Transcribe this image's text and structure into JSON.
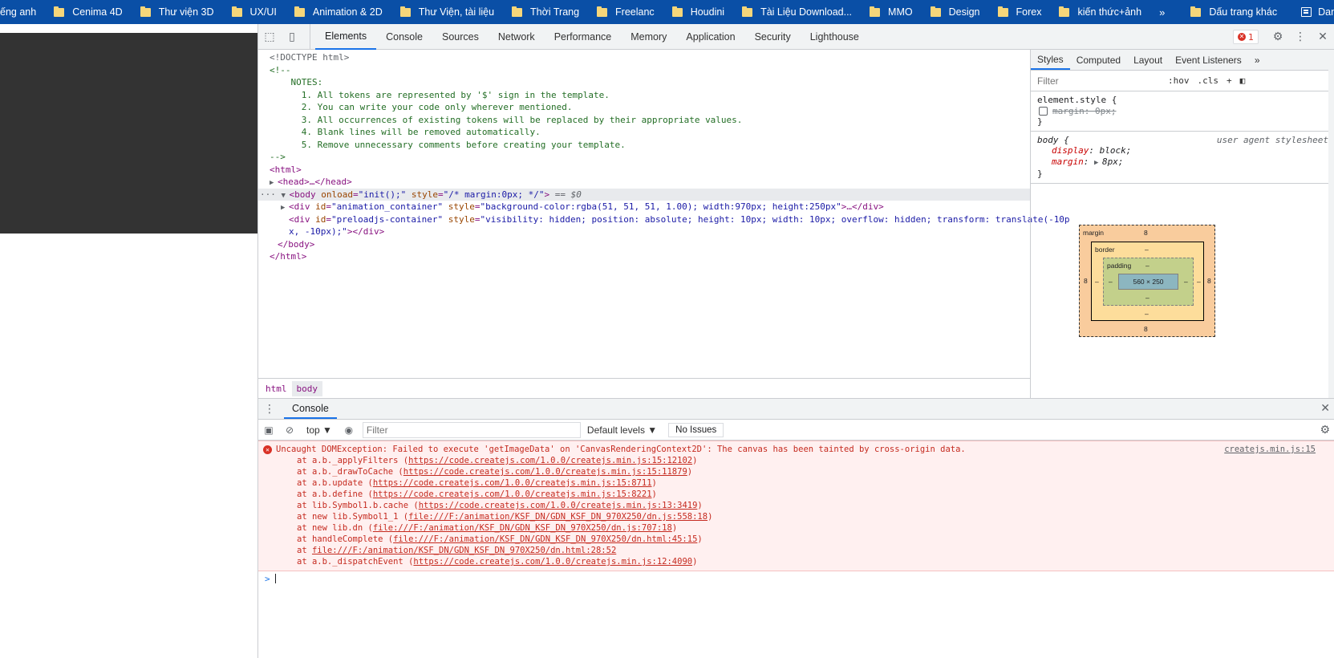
{
  "bookmarks": {
    "items": [
      {
        "label": "ếng anh",
        "has_folder": false
      },
      {
        "label": "Cenima 4D",
        "has_folder": true
      },
      {
        "label": "Thư viện 3D",
        "has_folder": true
      },
      {
        "label": "UX/UI",
        "has_folder": true
      },
      {
        "label": "Animation & 2D",
        "has_folder": true
      },
      {
        "label": "Thư Viện, tài liệu",
        "has_folder": true
      },
      {
        "label": "Thời Trang",
        "has_folder": true
      },
      {
        "label": "Freelanc",
        "has_folder": true
      },
      {
        "label": "Houdini",
        "has_folder": true
      },
      {
        "label": "Tài Liệu Download...",
        "has_folder": true
      },
      {
        "label": "MMO",
        "has_folder": true
      },
      {
        "label": "Design",
        "has_folder": true
      },
      {
        "label": "Forex",
        "has_folder": true
      },
      {
        "label": "kiến thức+ảnh",
        "has_folder": true
      }
    ],
    "overflow": "»",
    "other_bookmarks": "Dấu trang khác",
    "reading_list": "Danh sách đọc"
  },
  "devtools": {
    "tabs": [
      "Elements",
      "Console",
      "Sources",
      "Network",
      "Performance",
      "Memory",
      "Application",
      "Security",
      "Lighthouse"
    ],
    "active_tab": "Elements",
    "error_count": "1",
    "dom": {
      "doctype": "<!DOCTYPE html>",
      "comment_open": "<!--",
      "notes_title": "NOTES:",
      "notes": [
        "1. All tokens are represented by '$' sign in the template.",
        "2. You can write your code only wherever mentioned.",
        "3. All occurrences of existing tokens will be replaced by their appropriate values.",
        "4. Blank lines will be removed automatically.",
        "5. Remove unnecessary comments before creating your template."
      ],
      "comment_close": "-->",
      "html_open": "<html>",
      "head_collapsed": "<head>…</head>",
      "body_tag": "body",
      "body_attr1_name": "onload",
      "body_attr1_val": "\"init();\"",
      "body_attr2_name": "style",
      "body_attr2_val": "\"/* margin:0px; */\"",
      "body_ref": "== $0",
      "div1_id": "\"animation_container\"",
      "div1_style": "\"background-color:rgba(51, 51, 51, 1.00); width:970px; height:250px\"",
      "div2_id": "\"preloadjs-container\"",
      "div2_style_a": "\"visibility: hidden; position: absolute; height: 10px; width: 10px; overflow: hidden; transform: translate(-10p",
      "div2_style_b": "x, -10px);\"",
      "body_close": "</body>",
      "html_close": "</html>"
    },
    "breadcrumbs": [
      "html",
      "body"
    ],
    "styles": {
      "tabs": [
        "Styles",
        "Computed",
        "Layout",
        "Event Listeners"
      ],
      "more": "»",
      "filter_placeholder": "Filter",
      "hov": ":hov",
      "cls": ".cls",
      "plus": "+",
      "rule1_selector": "element.style {",
      "rule1_prop": "margin: 0px;",
      "rule2_selector": "body {",
      "rule2_source": "user agent stylesheet",
      "rule2_prop1_name": "display",
      "rule2_prop1_val": "block;",
      "rule2_prop2_name": "margin",
      "rule2_prop2_val": "8px;",
      "close_brace": "}"
    },
    "boxmodel": {
      "margin_label": "margin",
      "border_label": "border",
      "padding_label": "padding",
      "margin_top": "8",
      "margin_bottom": "8",
      "margin_left": "8",
      "margin_right": "8",
      "dash": "–",
      "content_size": "560 × 250"
    },
    "console": {
      "drawer_tab": "Console",
      "context": "top ▼",
      "filter_placeholder": "Filter",
      "levels": "Default levels ▼",
      "issues": "No Issues",
      "error_message": "Uncaught DOMException: Failed to execute 'getImageData' on 'CanvasRenderingContext2D': The canvas has been tainted by cross-origin data.",
      "error_source": "createjs.min.js:15",
      "stack": [
        {
          "prefix": "at a.b._applyFilters (",
          "link": "https://code.createjs.com/1.0.0/createjs.min.js:15:12102",
          "suffix": ")"
        },
        {
          "prefix": "at a.b._drawToCache (",
          "link": "https://code.createjs.com/1.0.0/createjs.min.js:15:11879",
          "suffix": ")"
        },
        {
          "prefix": "at a.b.update (",
          "link": "https://code.createjs.com/1.0.0/createjs.min.js:15:8711",
          "suffix": ")"
        },
        {
          "prefix": "at a.b.define (",
          "link": "https://code.createjs.com/1.0.0/createjs.min.js:15:8221",
          "suffix": ")"
        },
        {
          "prefix": "at lib.Symbol1.b.cache (",
          "link": "https://code.createjs.com/1.0.0/createjs.min.js:13:3419",
          "suffix": ")"
        },
        {
          "prefix": "at new lib.Symbol1_1 (",
          "link": "file:///F:/animation/KSF_DN/GDN_KSF_DN_970X250/dn.js:558:18",
          "suffix": ")"
        },
        {
          "prefix": "at new lib.dn (",
          "link": "file:///F:/animation/KSF_DN/GDN_KSF_DN_970X250/dn.js:707:18",
          "suffix": ")"
        },
        {
          "prefix": "at handleComplete (",
          "link": "file:///F:/animation/KSF_DN/GDN_KSF_DN_970X250/dn.html:45:15",
          "suffix": ")"
        },
        {
          "prefix": "at ",
          "link": "file:///F:/animation/KSF_DN/GDN_KSF_DN_970X250/dn.html:28:52",
          "suffix": ""
        },
        {
          "prefix": "at a.b._dispatchEvent (",
          "link": "https://code.createjs.com/1.0.0/createjs.min.js:12:4090",
          "suffix": ")"
        }
      ],
      "prompt": ">"
    }
  },
  "colors": {
    "bookmarks_bg": "#0a4fa6",
    "canvas_bg": "#333333",
    "accent": "#1a73e8",
    "error": "#d93025"
  }
}
